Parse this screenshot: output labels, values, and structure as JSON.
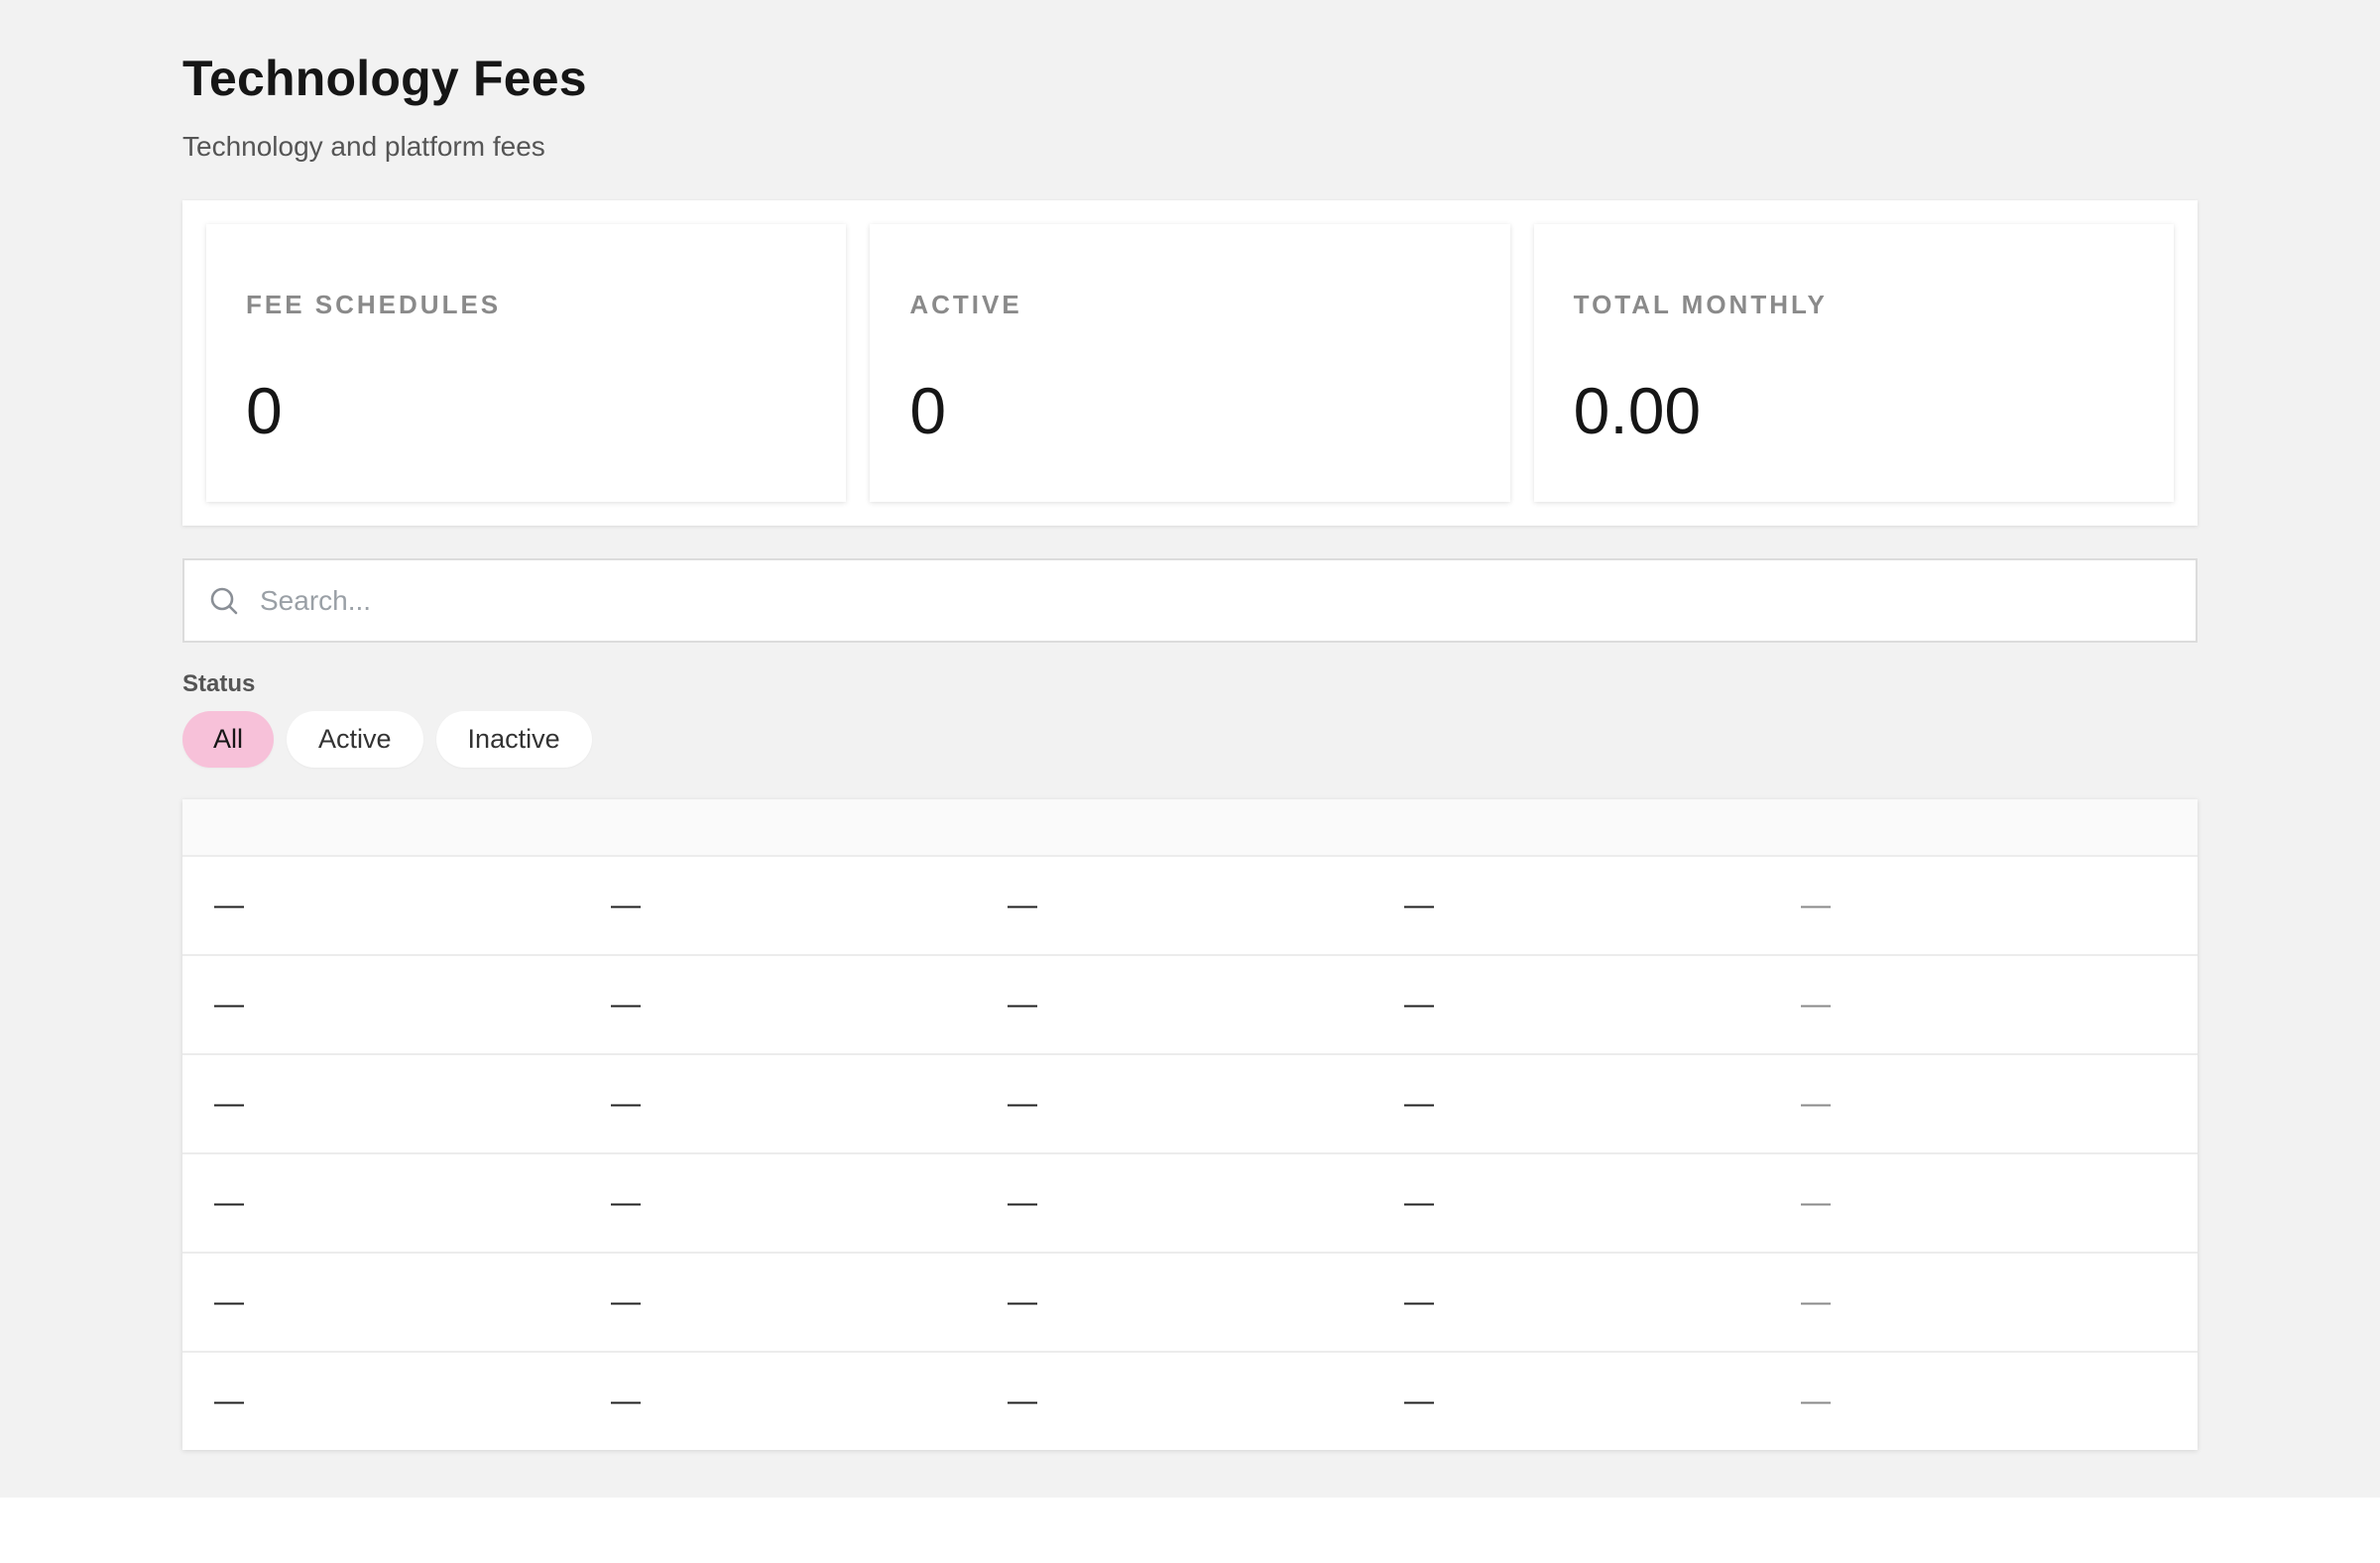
{
  "header": {
    "title": "Technology Fees",
    "subtitle": "Technology and platform fees"
  },
  "stats": [
    {
      "label": "FEE SCHEDULES",
      "value": "0"
    },
    {
      "label": "ACTIVE",
      "value": "0"
    },
    {
      "label": "TOTAL MONTHLY",
      "value": "0.00"
    }
  ],
  "search": {
    "placeholder": "Search...",
    "icon": "search-icon"
  },
  "filters": {
    "label": "Status",
    "options": [
      "All",
      "Active",
      "Inactive"
    ],
    "selected": "All",
    "selected_color": "#f7c1d9"
  },
  "table": {
    "rows": [
      [
        "—",
        "—",
        "—",
        "—",
        "—"
      ],
      [
        "—",
        "—",
        "—",
        "—",
        "—"
      ],
      [
        "—",
        "—",
        "—",
        "—",
        "—"
      ],
      [
        "—",
        "—",
        "—",
        "—",
        "—"
      ],
      [
        "—",
        "—",
        "—",
        "—",
        "—"
      ],
      [
        "—",
        "—",
        "—",
        "—",
        "—"
      ]
    ]
  }
}
